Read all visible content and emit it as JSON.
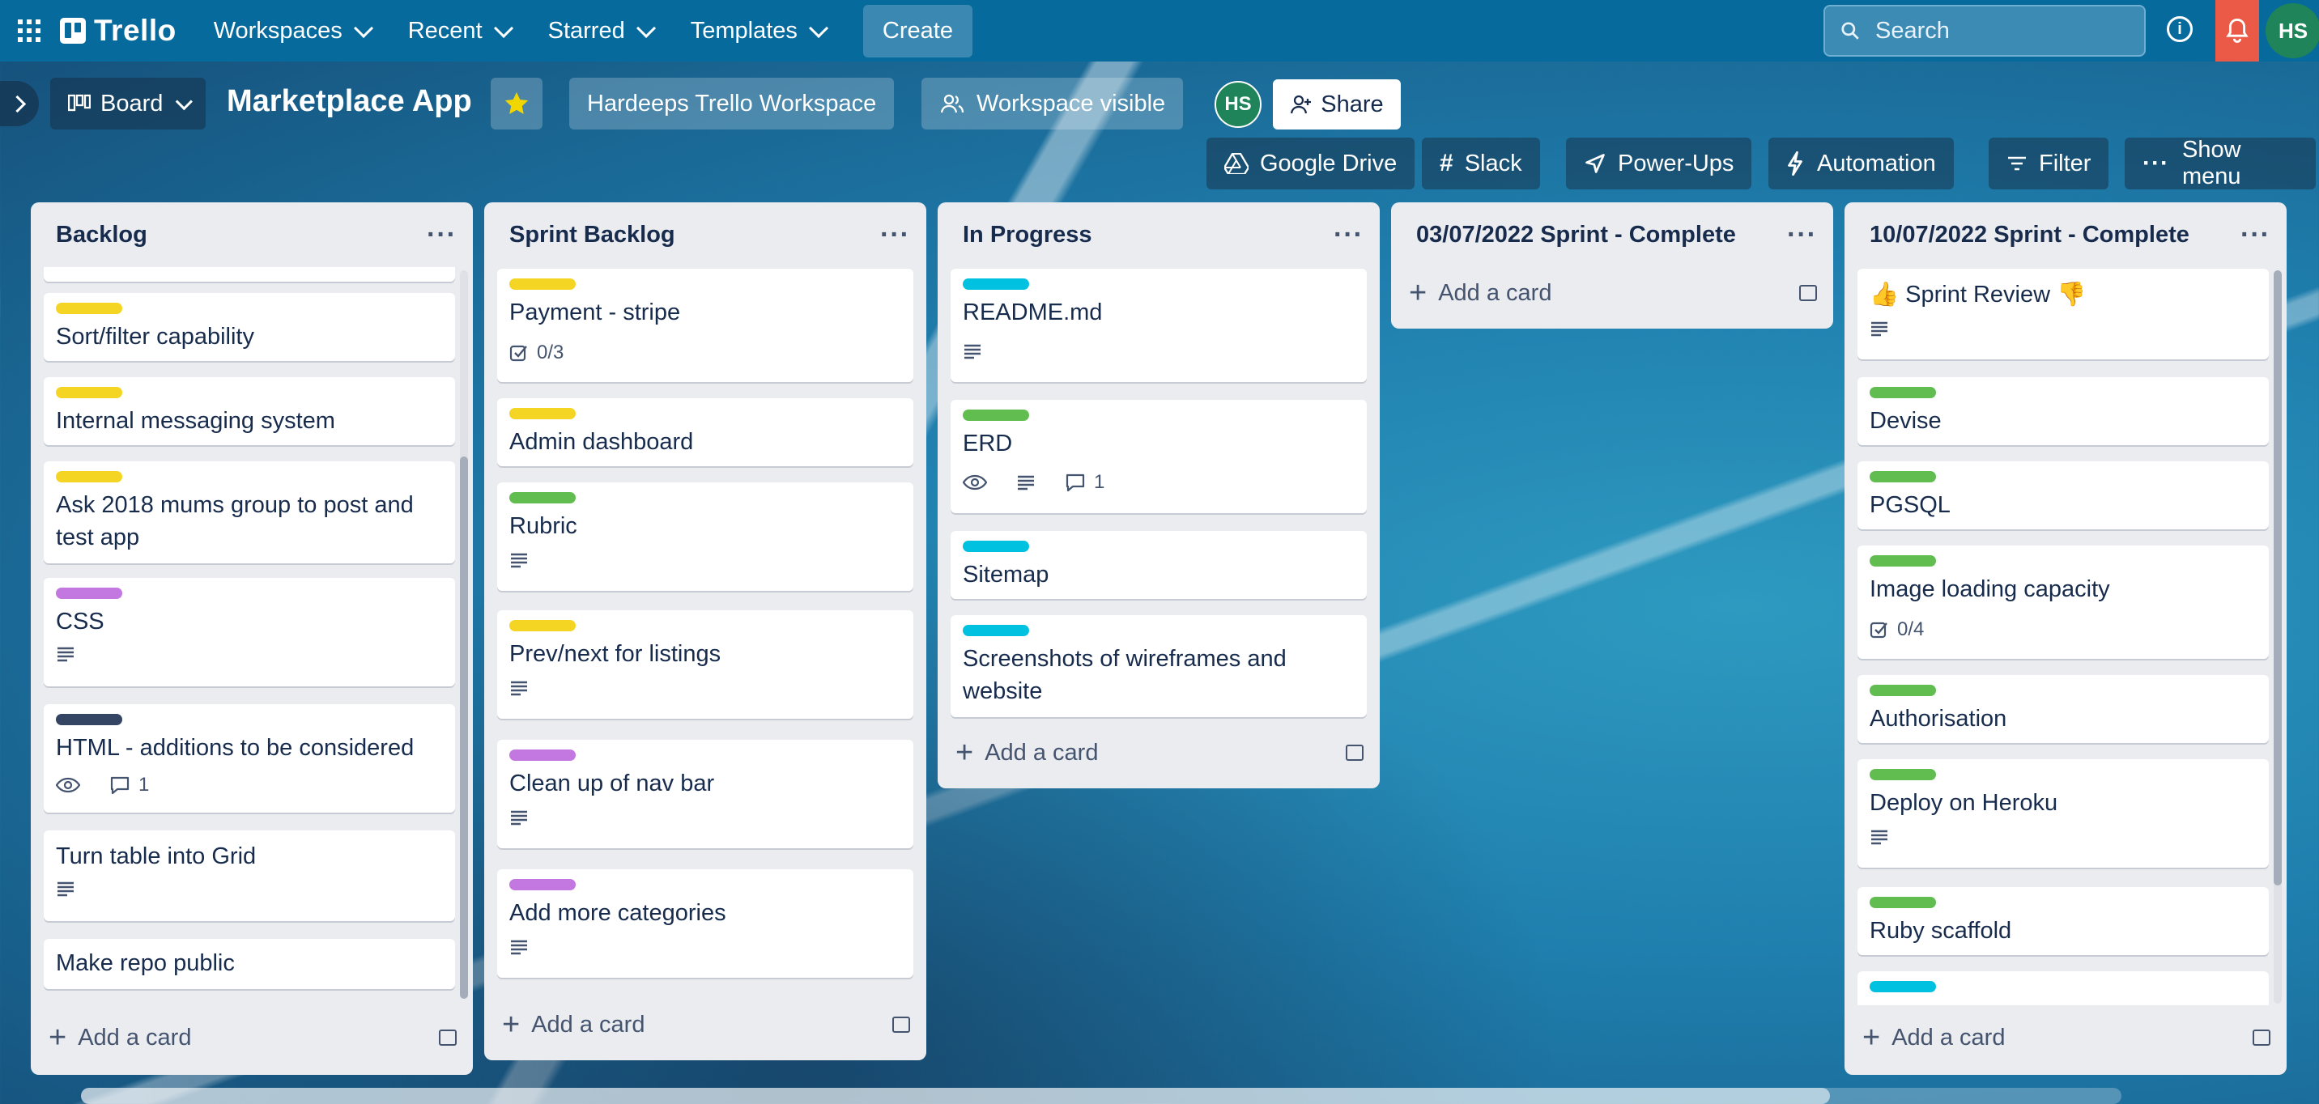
{
  "app": {
    "logo": "Trello"
  },
  "topnav": {
    "items": [
      "Workspaces",
      "Recent",
      "Starred",
      "Templates"
    ],
    "create": "Create",
    "search_placeholder": "Search",
    "avatar": "HS"
  },
  "board": {
    "view": "Board",
    "title": "Marketplace App",
    "workspace": "Hardeeps Trello Workspace",
    "visibility": "Workspace visible",
    "member": "HS",
    "share": "Share",
    "powerups": [
      "Google Drive",
      "Slack",
      "Power-Ups",
      "Automation"
    ],
    "filter": "Filter",
    "show_menu": "Show menu"
  },
  "colors": {
    "yellow": "#f5d524",
    "green": "#61bd4f",
    "purple": "#c377e0",
    "navy": "#344563",
    "cyan": "#00c2e0",
    "topbar": "#066a9c",
    "star": "#f2d600",
    "notify": "#eb5a46",
    "avatar": "#1f845a"
  },
  "add_card": "Add a card",
  "lists": [
    {
      "title": "Backlog",
      "cards": [
        {
          "title": "Sort/filter capability",
          "label": "yellow"
        },
        {
          "title": "Internal messaging system",
          "label": "yellow"
        },
        {
          "title": "Ask 2018 mums group to post and",
          "title2": "test app",
          "label": "yellow"
        },
        {
          "title": "CSS",
          "label": "purple",
          "description": true
        },
        {
          "title": "HTML - additions to be considered",
          "label": "navy",
          "watch": true,
          "comments": "1"
        },
        {
          "title": "Turn table into Grid",
          "description": true
        },
        {
          "title": "Make repo public"
        }
      ]
    },
    {
      "title": "Sprint Backlog",
      "cards": [
        {
          "title": "Payment - stripe",
          "label": "yellow",
          "checklist": "0/3"
        },
        {
          "title": "Admin dashboard",
          "label": "yellow"
        },
        {
          "title": "Rubric",
          "label": "green",
          "description": true
        },
        {
          "title": "Prev/next for listings",
          "label": "yellow",
          "description": true
        },
        {
          "title": "Clean up of nav bar",
          "label": "purple",
          "description": true
        },
        {
          "title": "Add more categories",
          "label": "purple",
          "description": true
        }
      ]
    },
    {
      "title": "In Progress",
      "cards": [
        {
          "title": "README.md",
          "label": "cyan",
          "description": true
        },
        {
          "title": "ERD",
          "label": "green",
          "watch": true,
          "description": true,
          "comments": "1"
        },
        {
          "title": "Sitemap",
          "label": "cyan"
        },
        {
          "title": "Screenshots of wireframes and",
          "title2": "website",
          "label": "cyan"
        }
      ]
    },
    {
      "title": "03/07/2022 Sprint - Complete",
      "cards": []
    },
    {
      "title": "10/07/2022 Sprint - Complete",
      "cards": [
        {
          "title": "👍 Sprint Review 👎",
          "description": true
        },
        {
          "title": "Devise",
          "label": "green"
        },
        {
          "title": "PGSQL",
          "label": "green"
        },
        {
          "title": "Image loading capacity",
          "label": "green",
          "checklist": "0/4"
        },
        {
          "title": "Authorisation",
          "label": "green"
        },
        {
          "title": "Deploy on Heroku",
          "label": "green",
          "description": true
        },
        {
          "title": "Ruby scaffold",
          "label": "green"
        },
        {
          "title": "",
          "label": "cyan"
        }
      ]
    }
  ]
}
